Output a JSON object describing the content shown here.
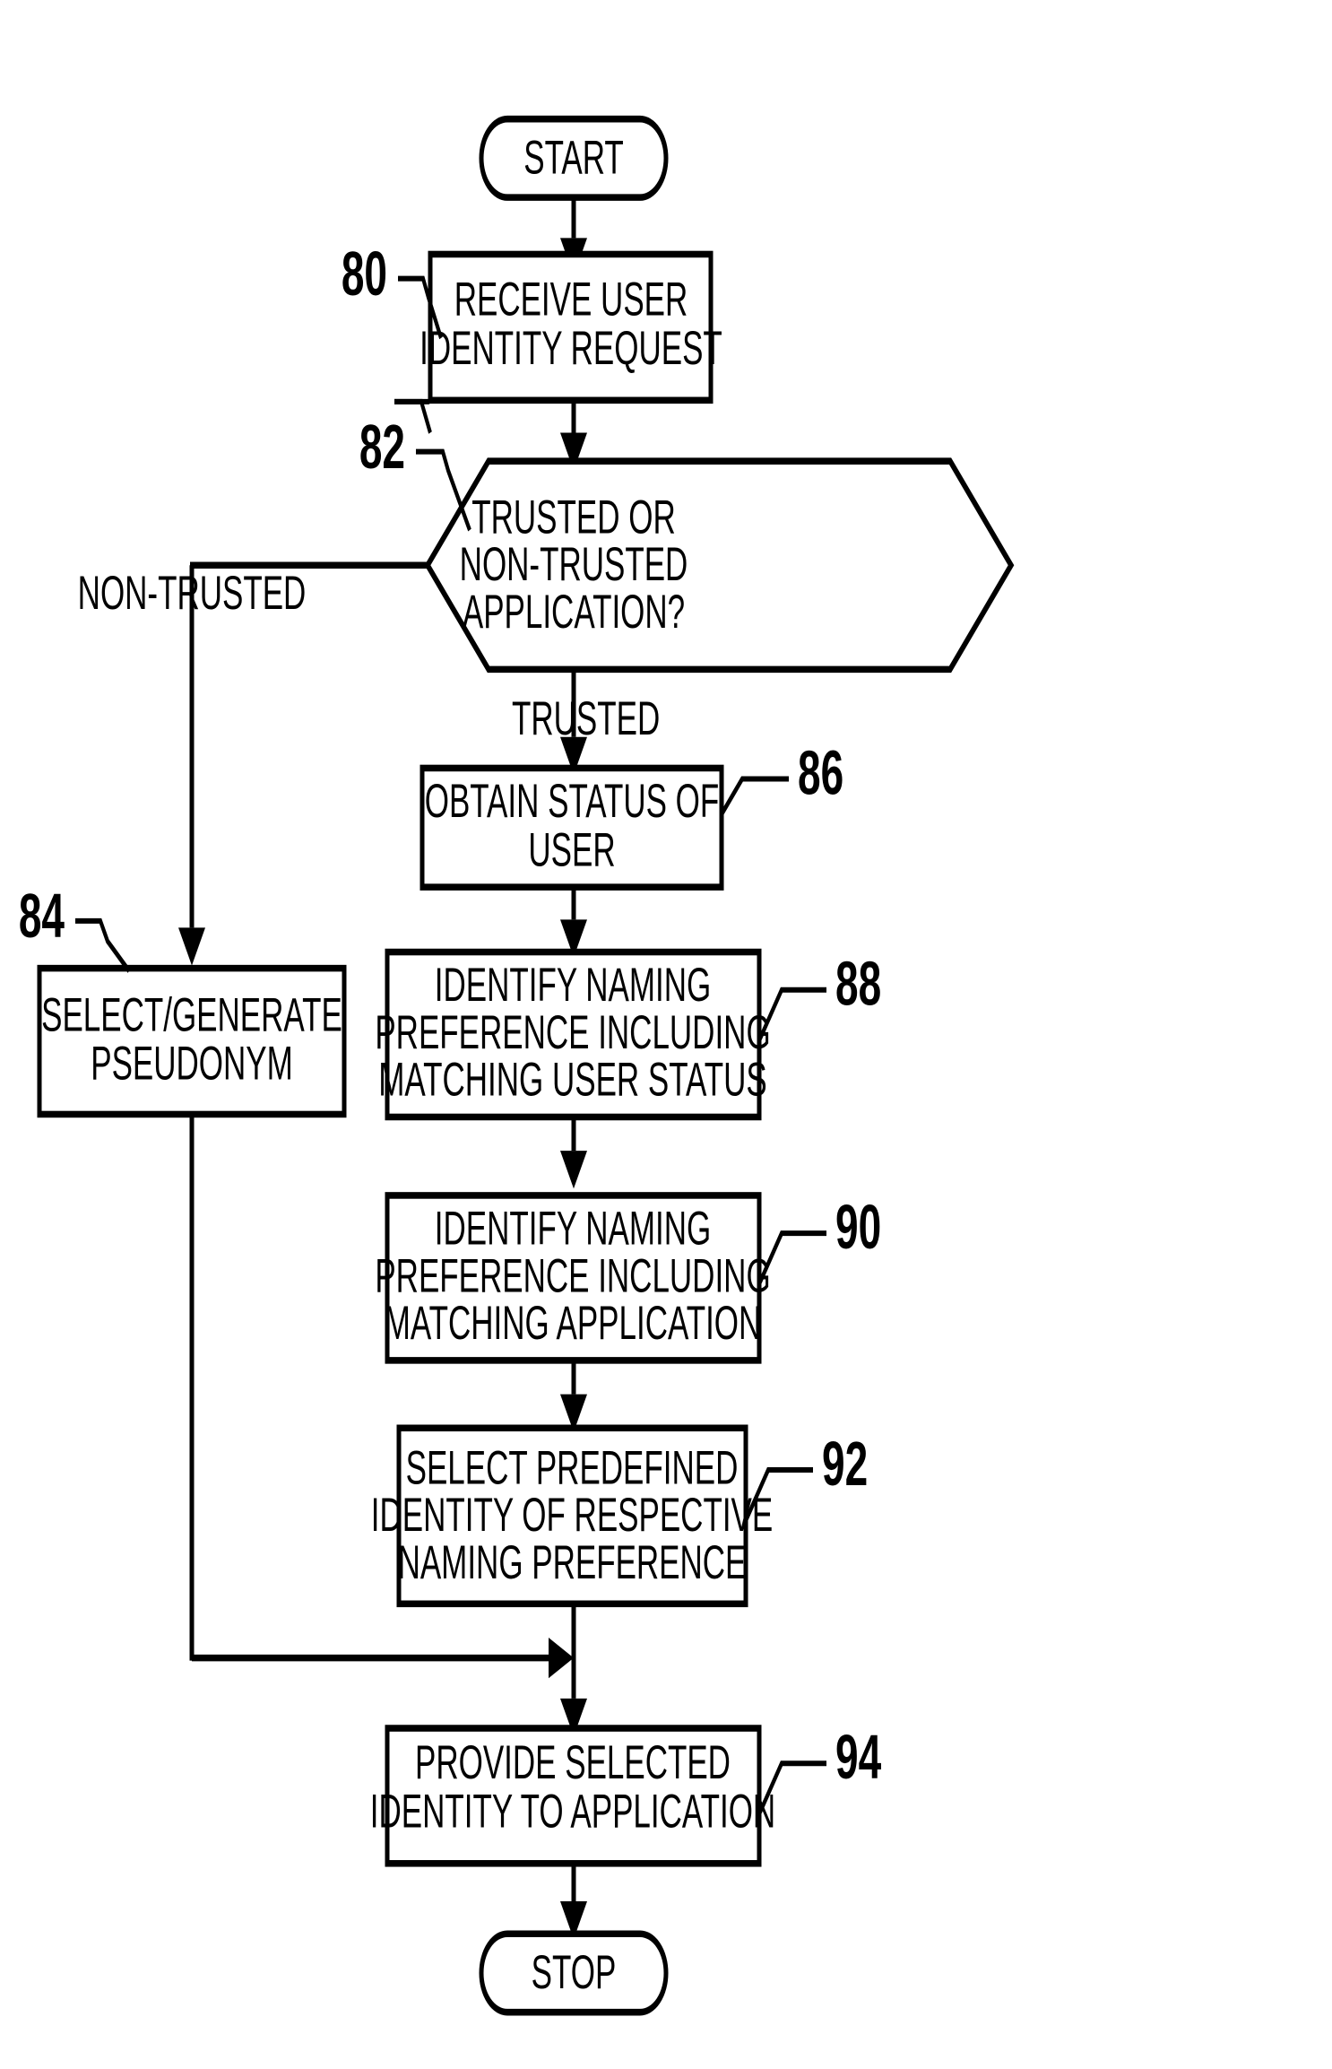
{
  "figure": {
    "type": "flowchart",
    "orientation": "vertical",
    "background_color": "#ffffff",
    "line_color": "#000000"
  },
  "terminators": {
    "start": {
      "label": "START"
    },
    "stop": {
      "label": "STOP"
    }
  },
  "nodes": [
    {
      "id": "n80",
      "ref": "80",
      "shape": "process",
      "lines": [
        "RECEIVE USER",
        "IDENTITY REQUEST"
      ]
    },
    {
      "id": "n82",
      "ref": "82",
      "shape": "decision-hexagon",
      "lines": [
        "TRUSTED OR",
        "NON-TRUSTED",
        "APPLICATION?"
      ]
    },
    {
      "id": "n84",
      "ref": "84",
      "shape": "process",
      "lines": [
        "SELECT/GENERATE",
        "PSEUDONYM"
      ]
    },
    {
      "id": "n86",
      "ref": "86",
      "shape": "process",
      "lines": [
        "OBTAIN STATUS OF",
        "USER"
      ]
    },
    {
      "id": "n88",
      "ref": "88",
      "shape": "process",
      "lines": [
        "IDENTIFY NAMING",
        "PREFERENCE INCLUDING",
        "MATCHING USER STATUS"
      ]
    },
    {
      "id": "n90",
      "ref": "90",
      "shape": "process",
      "lines": [
        "IDENTIFY NAMING",
        "PREFERENCE INCLUDING",
        "MATCHING APPLICATION"
      ]
    },
    {
      "id": "n92",
      "ref": "92",
      "shape": "process",
      "lines": [
        "SELECT PREDEFINED",
        "IDENTITY OF RESPECTIVE",
        "NAMING PREFERENCE"
      ]
    },
    {
      "id": "n94",
      "ref": "94",
      "shape": "process",
      "lines": [
        "PROVIDE SELECTED",
        "IDENTITY TO APPLICATION"
      ]
    }
  ],
  "branch_labels": {
    "non_trusted": "NON-TRUSTED",
    "trusted": "TRUSTED"
  },
  "reference_numerals": {
    "n80": "80",
    "n82": "82",
    "n84": "84",
    "n86": "86",
    "n88": "88",
    "n90": "90",
    "n92": "92",
    "n94": "94"
  }
}
